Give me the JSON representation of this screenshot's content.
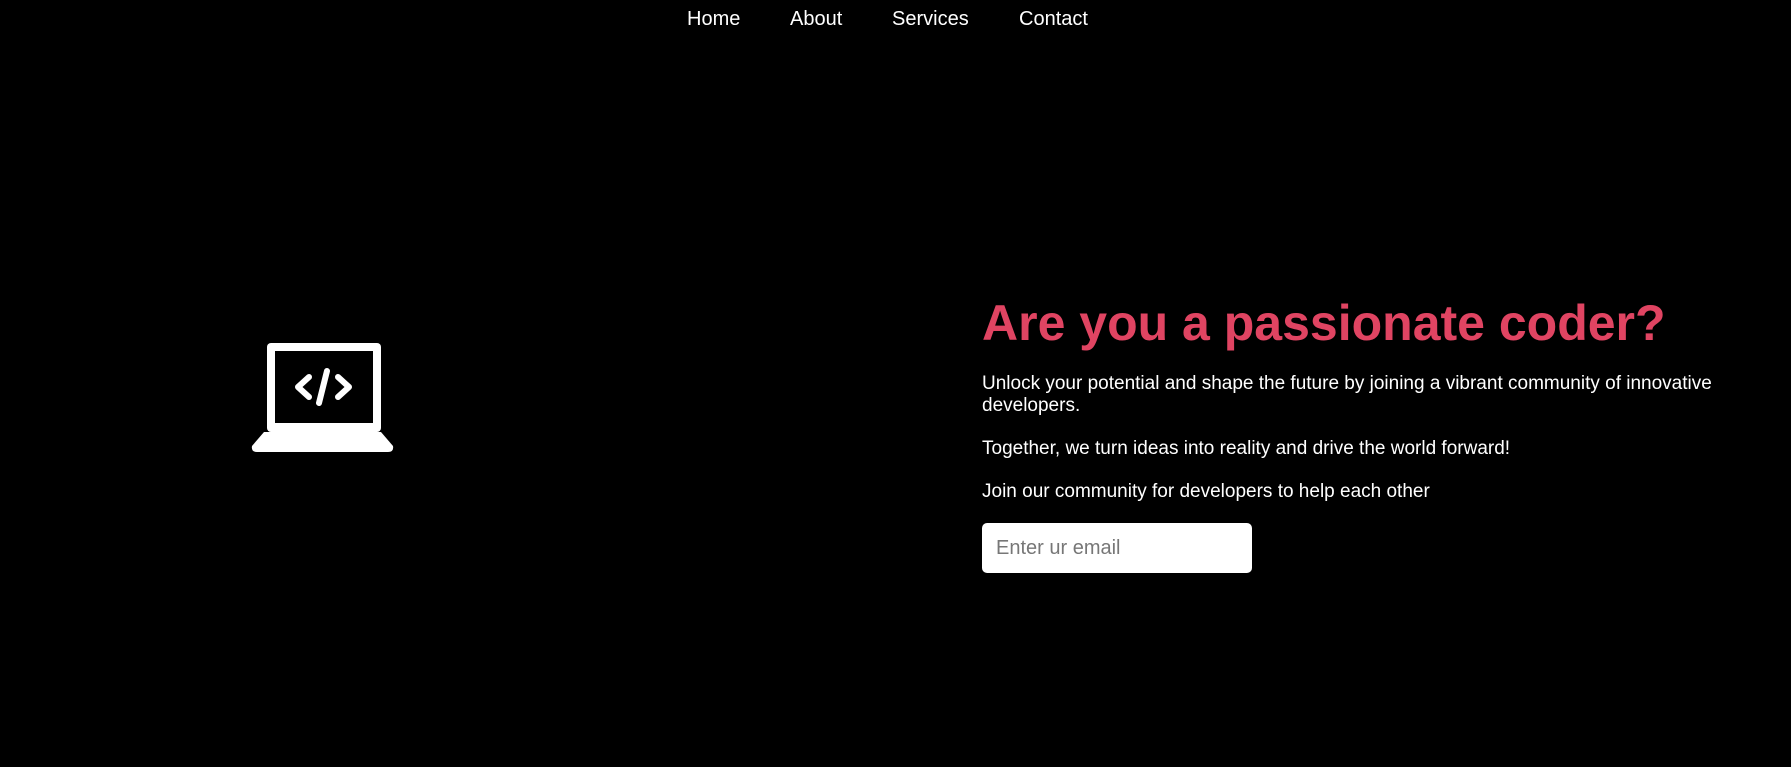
{
  "nav": {
    "items": [
      {
        "label": "Home"
      },
      {
        "label": "About"
      },
      {
        "label": "Services"
      },
      {
        "label": "Contact"
      }
    ]
  },
  "hero": {
    "icon": "laptop-code-icon",
    "headline": "Are you a passionate coder?",
    "paragraph_1": "Unlock your potential and shape the future by joining a vibrant community of innovative developers.",
    "paragraph_2": "Together, we turn ideas into reality and drive the world forward!",
    "paragraph_3": "Join our community for developers to help each other",
    "email_placeholder": "Enter ur email",
    "email_value": ""
  },
  "colors": {
    "background": "#000000",
    "text": "#ffffff",
    "accent": "#e04462"
  }
}
